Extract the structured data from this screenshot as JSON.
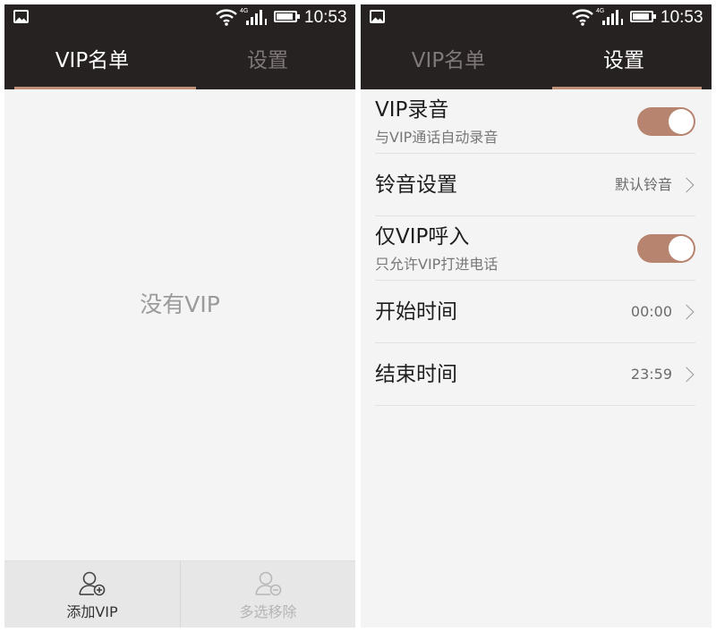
{
  "status_bar": {
    "network": "4G",
    "time": "10:53"
  },
  "tabs": [
    {
      "label": "VIP名单"
    },
    {
      "label": "设置"
    }
  ],
  "vip_list": {
    "empty_message": "没有VIP"
  },
  "bottom_actions": {
    "add_label": "添加VIP",
    "remove_label": "多选移除"
  },
  "settings": {
    "vip_recording": {
      "title": "VIP录音",
      "subtitle": "与VIP通话自动录音",
      "enabled": true
    },
    "ringtone": {
      "title": "铃音设置",
      "value": "默认铃音"
    },
    "vip_only_calls": {
      "title": "仅VIP呼入",
      "subtitle": "只允许VIP打进电话",
      "enabled": true
    },
    "start_time": {
      "title": "开始时间",
      "value": "00:00"
    },
    "end_time": {
      "title": "结束时间",
      "value": "23:59"
    }
  },
  "colors": {
    "header_bg": "#272222",
    "accent": "#c08f78",
    "toggle_on": "#b7846f",
    "inactive_tab": "#7e7877"
  },
  "icons": {
    "gallery": "gallery-icon",
    "wifi": "wifi-icon",
    "signal": "signal-icon",
    "battery": "battery-icon",
    "add_contact": "add-contact-icon",
    "remove_contact": "remove-contact-icon",
    "chevron": "chevron-right-icon"
  }
}
